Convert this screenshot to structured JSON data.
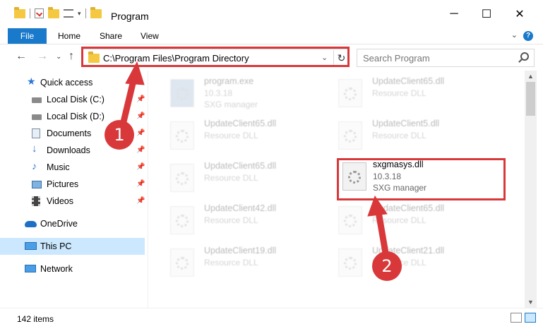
{
  "window": {
    "title": "Program",
    "minimize": "─",
    "maximize": "☐",
    "close": "✕"
  },
  "ribbon": {
    "tabs": [
      "File",
      "Home",
      "Share",
      "View"
    ],
    "help": "?",
    "collapse": "⌄"
  },
  "nav": {
    "back": "←",
    "forward": "→",
    "recent": "⌄",
    "up": "↑"
  },
  "address": {
    "path": "C:\\Program Files\\Program Directory",
    "dropdown": "⌄",
    "refresh": "↻"
  },
  "search": {
    "placeholder": "Search Program"
  },
  "sidebar": {
    "items": [
      {
        "label": "Quick access",
        "icon": "star-icon",
        "pinned": false
      },
      {
        "label": "Local Disk (C:)",
        "icon": "drive-icon",
        "pinned": true
      },
      {
        "label": "Local Disk (D:)",
        "icon": "drive-icon",
        "pinned": true
      },
      {
        "label": "Documents",
        "icon": "documents-icon",
        "pinned": true
      },
      {
        "label": "Downloads",
        "icon": "download-icon",
        "pinned": true
      },
      {
        "label": "Music",
        "icon": "music-icon",
        "pinned": true
      },
      {
        "label": "Pictures",
        "icon": "pictures-icon",
        "pinned": true
      },
      {
        "label": "Videos",
        "icon": "videos-icon",
        "pinned": true
      },
      {
        "label": "OneDrive",
        "icon": "cloud-icon",
        "pinned": false
      },
      {
        "label": "This PC",
        "icon": "computer-icon",
        "pinned": false,
        "selected": true
      },
      {
        "label": "Network",
        "icon": "network-icon",
        "pinned": false
      }
    ],
    "pin_glyph": "📌"
  },
  "files": [
    {
      "name": "program.exe",
      "version": "10.3.18",
      "desc": "SXG manager",
      "faded": true
    },
    {
      "name": "UpdateClient65.dll",
      "version": "Resource DLL",
      "desc": "",
      "faded": true
    },
    {
      "name": "UpdateClient65.dll",
      "version": "Resource DLL",
      "desc": "",
      "faded": true
    },
    {
      "name": "UpdateClient5.dll",
      "version": "Resource DLL",
      "desc": "",
      "faded": true
    },
    {
      "name": "UpdateClient65.dll",
      "version": "Resource DLL",
      "desc": "",
      "faded": true
    },
    {
      "name": "sxgmasys.dll",
      "version": "10.3.18",
      "desc": "SXG manager",
      "faded": false
    },
    {
      "name": "UpdateClient42.dll",
      "version": "Resource DLL",
      "desc": "",
      "faded": true
    },
    {
      "name": "UpdateClient65.dll",
      "version": "Resource DLL",
      "desc": "",
      "faded": true
    },
    {
      "name": "UpdateClient19.dll",
      "version": "Resource DLL",
      "desc": "",
      "faded": true
    },
    {
      "name": "UpdateClient21.dll",
      "version": "Resource DLL",
      "desc": "",
      "faded": true
    }
  ],
  "status": {
    "count": "142 items"
  },
  "annotations": {
    "badge1": "1",
    "badge2": "2",
    "color": "#d9383a"
  }
}
